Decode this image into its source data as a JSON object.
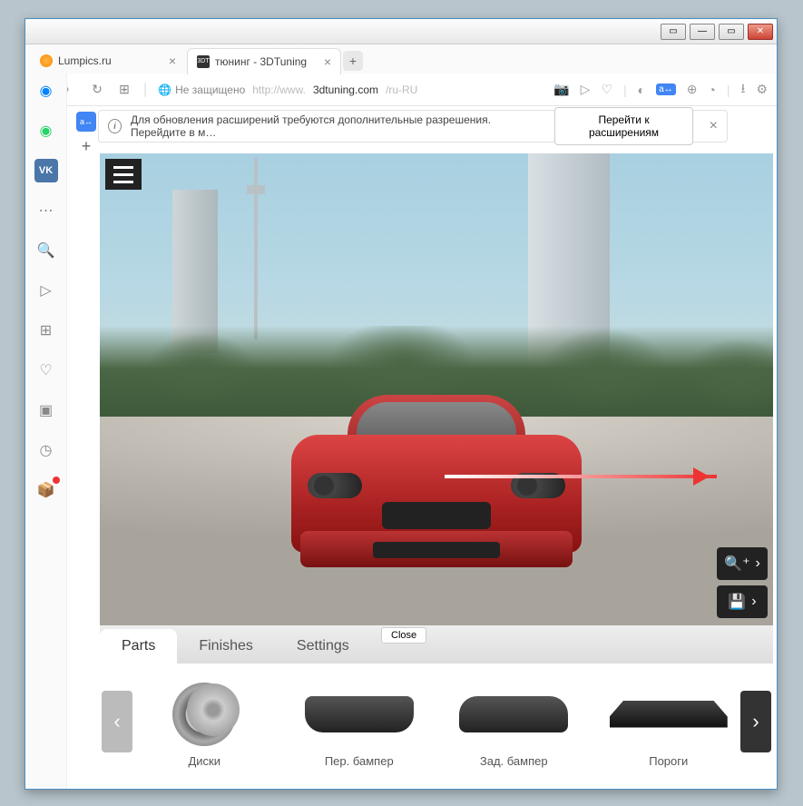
{
  "titlebar": {
    "min": "—",
    "max": "▭",
    "close": "✕",
    "extra": "▭"
  },
  "tabs": [
    {
      "title": "Lumpics.ru",
      "icon": "orange",
      "active": false
    },
    {
      "title": "тюнинг - 3DTuning",
      "icon": "3DT",
      "active": true
    }
  ],
  "address": {
    "secure_label": "Не защищено",
    "url_prefix": "http://www.",
    "url_host": "3dtuning.com",
    "url_path": "/ru-RU"
  },
  "notification": {
    "text": "Для обновления расширений требуются дополнительные разрешения. Перейдите в м…",
    "button": "Перейти к расширениям"
  },
  "app": {
    "tabs": {
      "parts": "Parts",
      "finishes": "Finishes",
      "settings": "Settings"
    },
    "close_label": "Close",
    "parts": [
      {
        "label": "Диски"
      },
      {
        "label": "Пер. бампер"
      },
      {
        "label": "Зад. бампер"
      },
      {
        "label": "Пороги"
      }
    ]
  }
}
